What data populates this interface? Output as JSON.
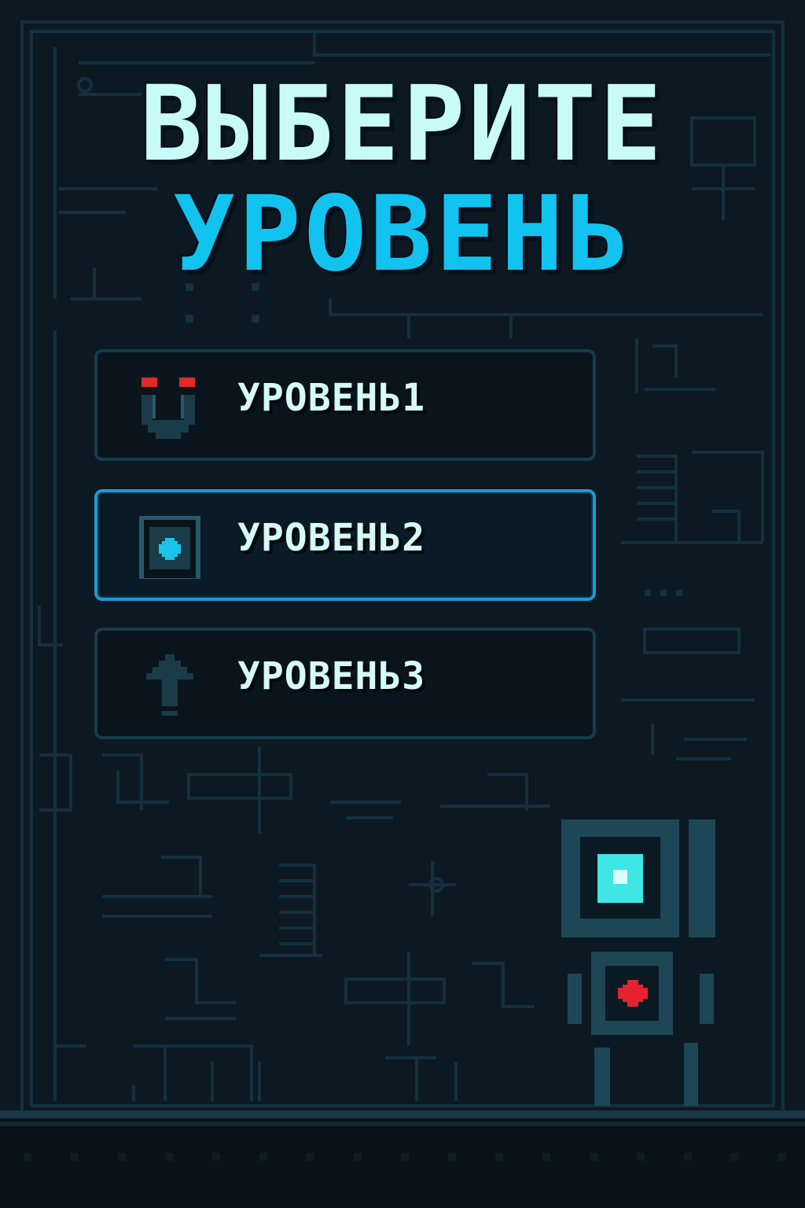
{
  "title": {
    "line1": "ВЫБЕРИТЕ",
    "line2": "УРОВЕНЬ"
  },
  "levels": [
    {
      "label": "УРОВЕНЬ1",
      "icon": "magnet-icon",
      "selected": false
    },
    {
      "label": "УРОВЕНЬ2",
      "icon": "button-block-icon",
      "selected": true
    },
    {
      "label": "УРОВЕНЬ3",
      "icon": "arrow-up-icon",
      "selected": false
    }
  ],
  "colors": {
    "background": "#0c1822",
    "title_primary": "#c8fbf8",
    "title_accent": "#12c3f0",
    "button_border": "#173b4a",
    "button_border_selected": "#1e9ad0",
    "label_text": "#d6fbf7",
    "magnet_red": "#e02a2a",
    "robot_cyan": "#3ee6e6",
    "robot_red": "#e4232f"
  }
}
